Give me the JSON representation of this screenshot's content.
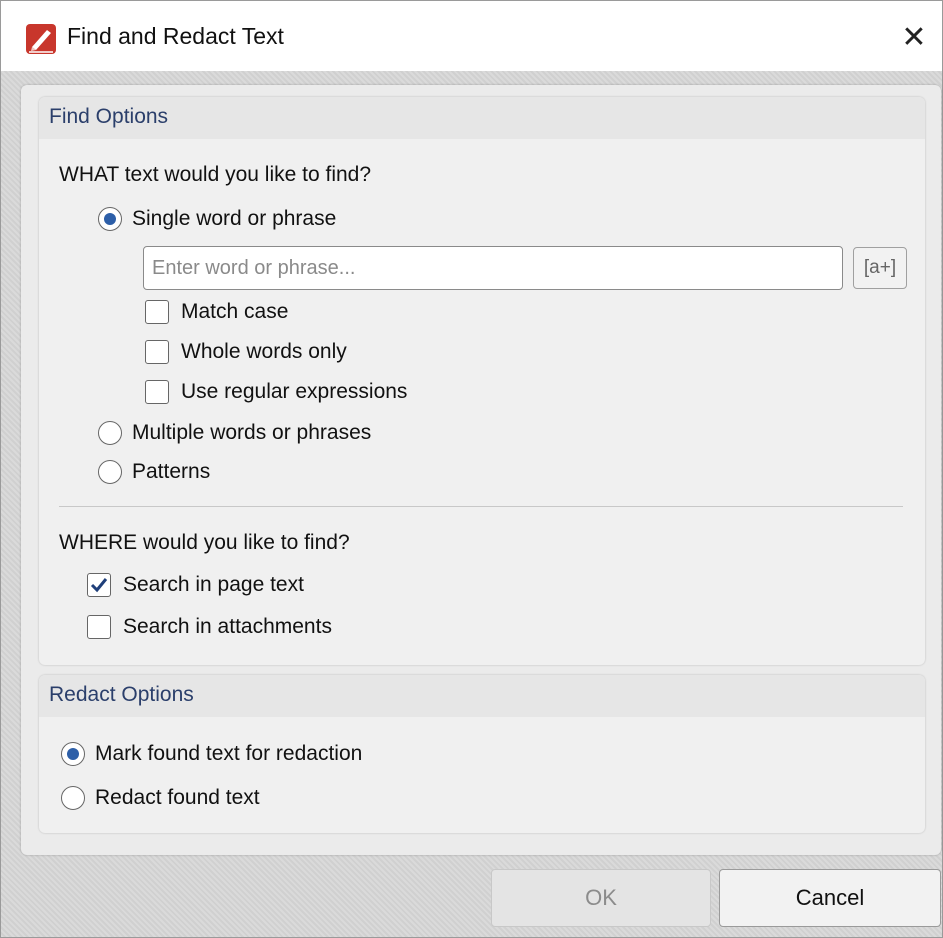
{
  "window": {
    "title": "Find and Redact Text",
    "close_glyph": "✕",
    "icon": "pdf-app-icon"
  },
  "find_options": {
    "title": "Find Options",
    "what_heading": "WHAT text would you like to find?",
    "single_word_label": "Single word or phrase",
    "search_placeholder": "Enter word or phrase...",
    "search_value": "",
    "aplus_label": "[a+]",
    "match_case_label": "Match case",
    "whole_words_label": "Whole words only",
    "regex_label": "Use regular expressions",
    "multiple_words_label": "Multiple words or phrases",
    "patterns_label": "Patterns",
    "where_heading": "WHERE would you like to find?",
    "search_page_text_label": "Search in page text",
    "search_attachments_label": "Search in attachments",
    "selected_what": "single",
    "match_case": false,
    "whole_words": false,
    "regex": false,
    "search_page_text": true,
    "search_attachments": false
  },
  "redact_options": {
    "title": "Redact Options",
    "mark_label": "Mark found text for redaction",
    "redact_label": "Redact found text",
    "selected": "mark"
  },
  "buttons": {
    "ok": "OK",
    "cancel": "Cancel",
    "ok_disabled": true
  },
  "colors": {
    "accent": "#2d5fa8",
    "group_title": "#2b3f6b",
    "checkmark": "#1f3f7a"
  }
}
